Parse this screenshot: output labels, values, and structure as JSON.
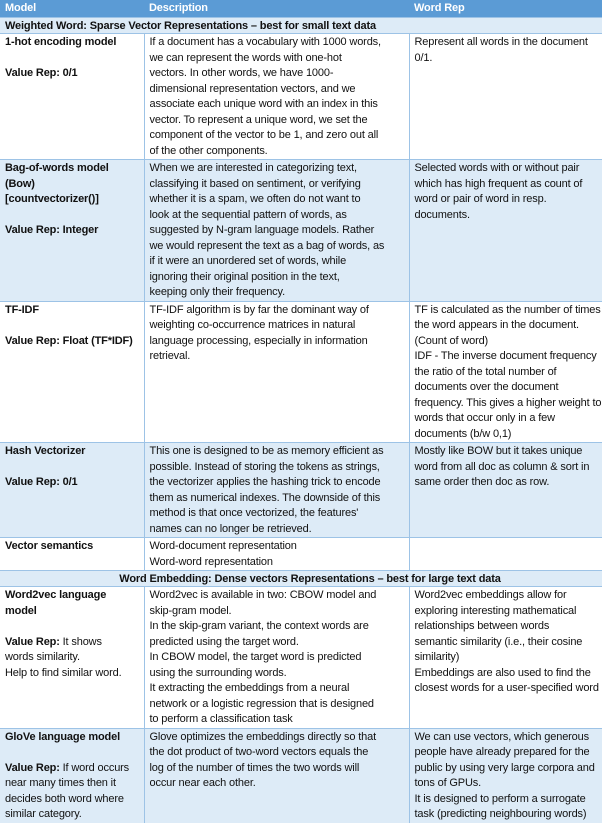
{
  "header": {
    "model": "Model",
    "description": "Description",
    "word_rep": "Word Rep"
  },
  "colors": {
    "header_bg": "#5b9bd5",
    "band_bg": "#ddebf7",
    "grid": "#9dc3e6"
  },
  "sections": [
    {
      "title": "Weighted Word: Sparse Vector Representations – best for small text data",
      "rows": [
        {
          "model": "1-hot encoding model",
          "value_label": "Value Rep: 0/1",
          "value_text": "",
          "description": "If a document has a vocabulary with 1000 words,\nwe can represent the words with one-hot\nvectors. In other words, we have 1000-\ndimensional representation vectors, and we\nassociate each unique word with an index in this\nvector. To represent a unique word, we set the\ncomponent of the vector to be 1, and zero out all\nof the other components.",
          "word_rep": "Represent all words in the document\n0/1."
        },
        {
          "model": "Bag-of-words model\n(Bow)\n[countvectorizer()]",
          "value_label": "Value Rep: Integer",
          "value_text": "",
          "description": "When we are interested in categorizing text,\nclassifying it based on sentiment, or verifying\nwhether it is a spam, we often do not want to\nlook at the sequential pattern of words, as\nsuggested by N-gram language models. Rather\nwe would represent the text as a bag of words, as\nif it were an unordered set of words, while\nignoring their original position in the text,\nkeeping only their frequency.",
          "word_rep": "Selected words with or without pair\nwhich has high frequent as count of\nword or pair of word in resp.\ndocuments."
        },
        {
          "model": "TF-IDF",
          "value_label": "Value Rep: Float (TF*IDF)",
          "value_text": "",
          "description": "TF-IDF algorithm is by far the dominant way of\nweighting co-occurrence matrices in natural\nlanguage processing, especially in information\nretrieval.",
          "word_rep": "TF is calculated as the number of times\nthe word appears in the document.\n(Count of word)\nIDF - The inverse document frequency\nthe ratio of the total number of\ndocuments over the document\nfrequency. This gives a higher weight to\nwords that occur only in a few\ndocuments (b/w 0,1)"
        },
        {
          "model": "Hash Vectorizer",
          "value_label": "Value Rep: 0/1",
          "value_text": "",
          "description": "This one is designed to be as memory efficient as\npossible. Instead of storing the tokens as strings,\nthe vectorizer applies the hashing trick to encode\nthem as numerical indexes. The downside of this\nmethod is that once vectorized, the features'\nnames can no longer be retrieved.",
          "word_rep": "Mostly like BOW but it takes unique\nword from all doc as column & sort in\nsame order then doc as row."
        },
        {
          "model": "Vector semantics",
          "value_label": "",
          "value_text": "",
          "description": "Word-document representation\nWord-word representation",
          "word_rep": ""
        }
      ]
    },
    {
      "title": "Word Embedding: Dense vectors Representations – best for large text data",
      "rows": [
        {
          "model": "Word2vec language\nmodel",
          "value_label": "Value Rep:",
          "value_text": " It shows\nwords similarity.\nHelp to find similar word.",
          "description": "Word2vec is available in two: CBOW model and\nskip-gram model.\nIn the skip-gram variant, the context words are\npredicted using the target word.\nIn CBOW model, the target word is predicted\nusing the surrounding words.\nIt extracting the embeddings from a neural\nnetwork or a logistic regression that is designed\nto perform a classification task",
          "word_rep": "Word2vec embeddings allow for\nexploring interesting mathematical\nrelationships between words\nsemantic similarity (i.e., their cosine\nsimilarity)\nEmbeddings are also used to find the\nclosest words for a user-specified word"
        },
        {
          "model": "GloVe language model",
          "value_label": "Value Rep:",
          "value_text": " If word occurs\nnear many times then it\ndecides both word where\nsimilar category.",
          "description": "Glove optimizes the embeddings directly so that\nthe dot product of two-word vectors equals the\nlog of the number of times the two words will\noccur near each other.",
          "word_rep": "We can use vectors, which generous\npeople have already prepared for the\npublic by using very large corpora and\ntons of GPUs.\nIt is designed to perform a surrogate\ntask (predicting neighbouring words)"
        }
      ]
    }
  ]
}
